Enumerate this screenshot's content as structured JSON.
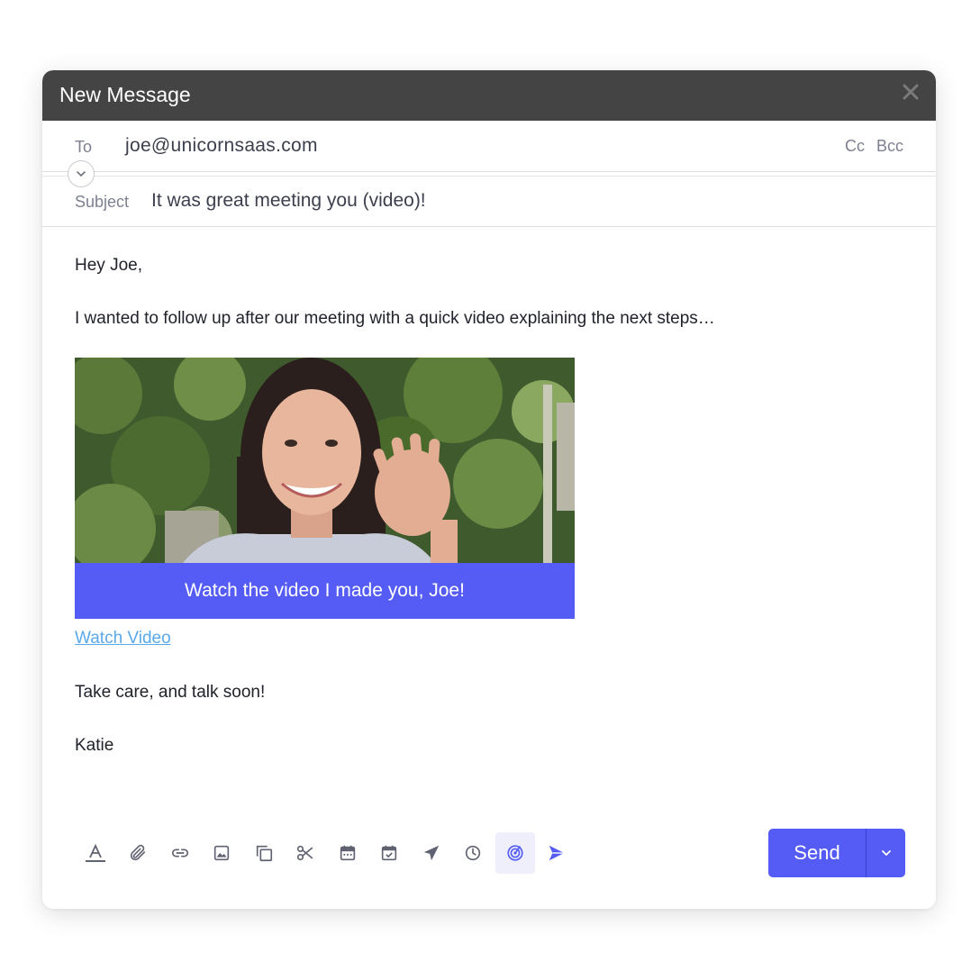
{
  "window": {
    "title": "New Message"
  },
  "header": {
    "to_label": "To",
    "to_value": "joe@unicornsaas.com",
    "cc_label": "Cc",
    "bcc_label": "Bcc",
    "subject_label": "Subject",
    "subject_value": "It was great meeting you (video)!"
  },
  "body": {
    "greeting": "Hey Joe,",
    "paragraph": "I wanted to follow up after our meeting with a quick video explaining the next steps…",
    "video_cta": "Watch the video I made you, Joe!",
    "watch_link": "Watch Video",
    "closing": "Take care, and talk soon!",
    "signature": "Katie"
  },
  "toolbar": {
    "icons": [
      "text-format-icon",
      "attachment-icon",
      "link-icon",
      "image-icon",
      "copy-icon",
      "scissors-icon",
      "calendar-icon",
      "calendar-check-icon",
      "send-later-icon",
      "clock-icon",
      "tracking-icon",
      "brand-app-icon"
    ],
    "send_label": "Send"
  },
  "colors": {
    "titlebar": "#444444",
    "accent": "#555cf6",
    "link": "#5aa9ea"
  }
}
